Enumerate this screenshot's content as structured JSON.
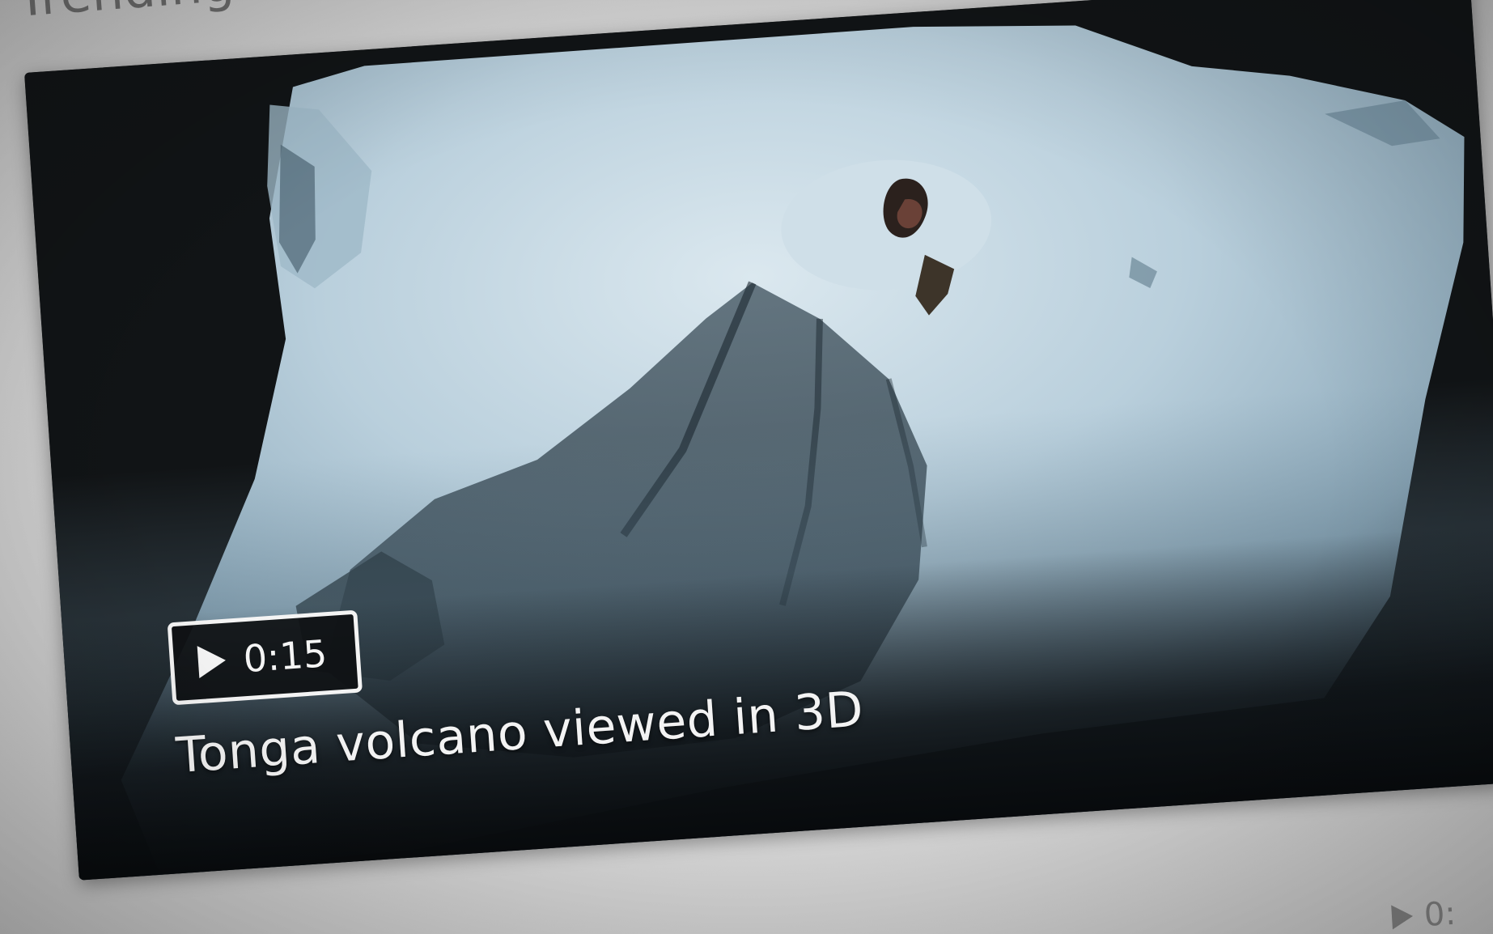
{
  "section": {
    "heading": "Trending video"
  },
  "featured_video": {
    "title": "Tonga volcano viewed in 3D",
    "duration": "0:15",
    "play_icon": "play-icon"
  },
  "next_video": {
    "duration_partial": "0:",
    "play_icon": "play-icon"
  },
  "colors": {
    "card_background": "#101214",
    "badge_background": "#0e1012",
    "badge_border": "#f4f4f4",
    "title_text": "#f3f3f3",
    "page_background": "#d9d9d9"
  }
}
